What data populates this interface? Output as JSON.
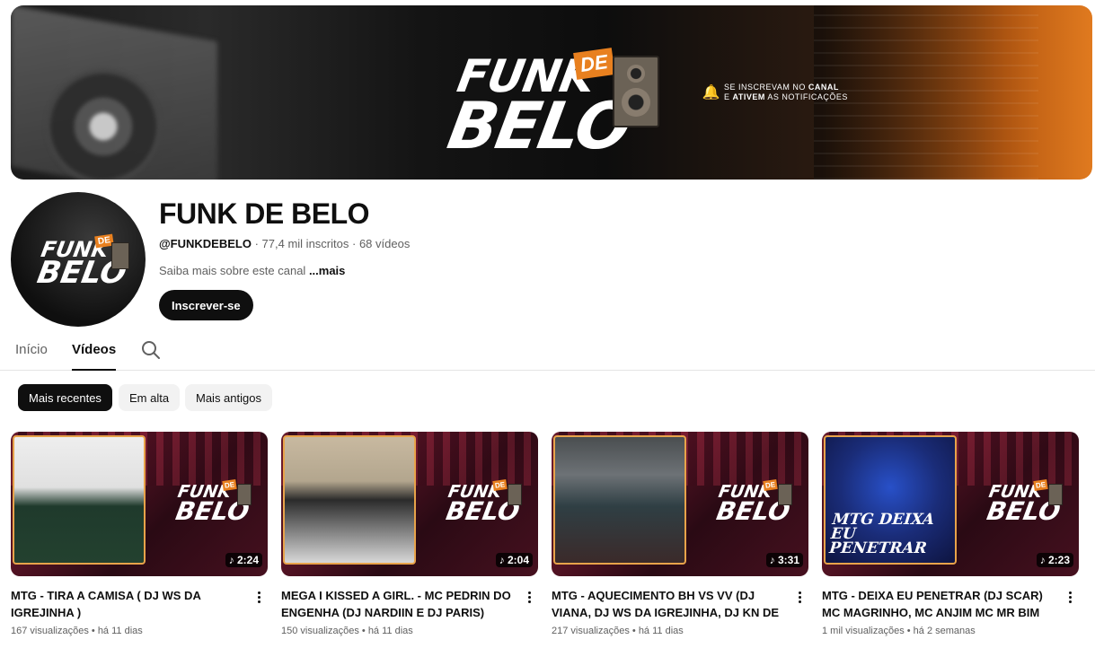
{
  "banner": {
    "logo_line1": "FUNK",
    "logo_de": "DE",
    "logo_line2": "BELO",
    "notice_line1_prefix": "SE INSCREVAM NO",
    "notice_line1_bold": "CANAL",
    "notice_line2_prefix": "E",
    "notice_line2_bold": "ATIVEM",
    "notice_line2_suffix": "AS NOTIFICAÇÕES",
    "accent_color": "#e8801f"
  },
  "channel": {
    "name": "FUNK DE BELO",
    "handle": "@FUNKDEBELO",
    "subscribers": "77,4 mil inscritos",
    "video_count": "68 vídeos",
    "separator": "·",
    "about": "Saiba mais sobre este canal",
    "more": "...mais",
    "subscribe_label": "Inscrever-se"
  },
  "tabs": [
    {
      "label": "Início",
      "active": false
    },
    {
      "label": "Vídeos",
      "active": true
    }
  ],
  "chips": [
    {
      "label": "Mais recentes",
      "active": true
    },
    {
      "label": "Em alta",
      "active": false
    },
    {
      "label": "Mais antigos",
      "active": false
    }
  ],
  "videos": [
    {
      "title": "MTG - TIRA A CAMISA ( DJ WS DA IGREJINHA )",
      "duration": "2:24",
      "views": "167 visualizações",
      "age": "há 11 dias"
    },
    {
      "title": "MEGA I KISSED A GIRL. - MC PEDRIN DO ENGENHA (DJ NARDIIN E DJ PARIS)",
      "duration": "2:04",
      "views": "150 visualizações",
      "age": "há 11 dias"
    },
    {
      "title": "MTG - AQUECIMENTO BH VS VV (DJ VIANA, DJ WS DA IGREJINHA, DJ KN DE VILA...",
      "duration": "3:31",
      "views": "217 visualizações",
      "age": "há 11 dias"
    },
    {
      "title": "MTG - DEIXA EU PENETRAR (DJ SCAR) MC MAGRINHO, MC ANJIM MC MR BIM",
      "duration": "2:23",
      "views": "1 mil visualizações",
      "age": "há 2 semanas",
      "thumb_text": "MTG DEIXA EU PENETRAR"
    }
  ],
  "icons": {
    "search": "search-icon",
    "bell": "bell-icon",
    "menu": "more-vert-icon",
    "music": "music-note-icon"
  }
}
